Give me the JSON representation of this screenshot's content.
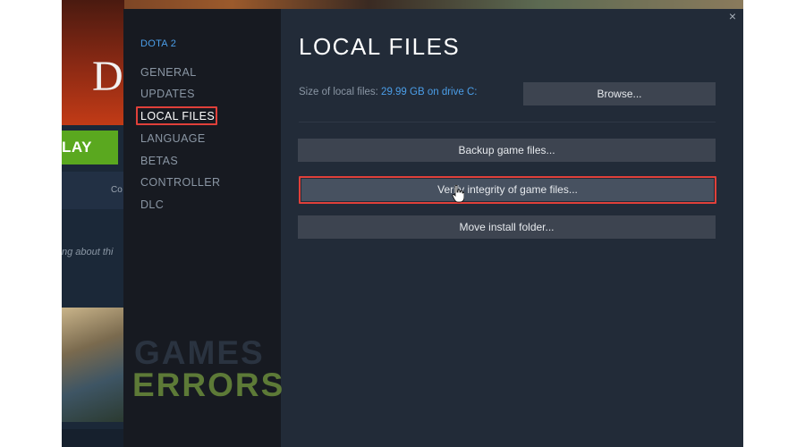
{
  "window": {
    "close_glyph": "×"
  },
  "background": {
    "logo_letter": "D",
    "play_label": "LAY",
    "side_text": "Co",
    "talk_text": "ng about thi"
  },
  "sidebar": {
    "game_title": "DOTA 2",
    "items": [
      {
        "label": "GENERAL",
        "active": false
      },
      {
        "label": "UPDATES",
        "active": false
      },
      {
        "label": "LOCAL FILES",
        "active": true
      },
      {
        "label": "LANGUAGE",
        "active": false
      },
      {
        "label": "BETAS",
        "active": false
      },
      {
        "label": "CONTROLLER",
        "active": false
      },
      {
        "label": "DLC",
        "active": false
      }
    ]
  },
  "main": {
    "title": "LOCAL FILES",
    "size_label": "Size of local files: ",
    "size_value": "29.99 GB on drive C:",
    "browse_label": "Browse...",
    "backup_label": "Backup game files...",
    "verify_label": "Verify integrity of game files...",
    "move_label": "Move install folder..."
  },
  "watermark": {
    "line1": "GAMES",
    "line2": "ERRORS"
  },
  "colors": {
    "accent_blue": "#4b9ee8",
    "highlight_red": "#e0403a",
    "play_green": "#5aa81f",
    "watermark_green": "#5d7a37"
  }
}
